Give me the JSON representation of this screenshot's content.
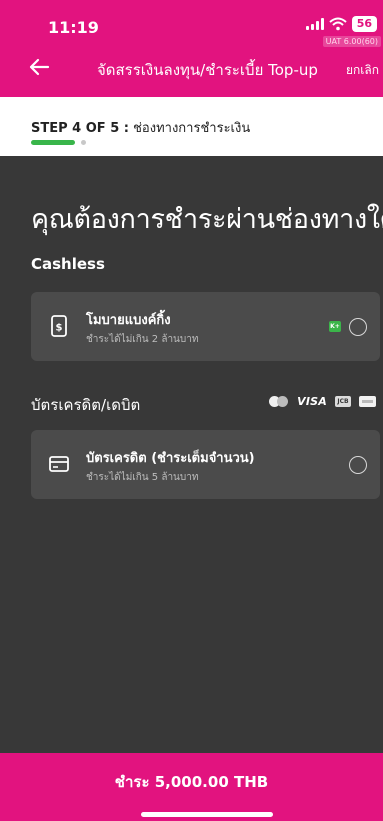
{
  "status_bar": {
    "time": "11:19",
    "battery": "56",
    "env_badge": "UAT 6.00(60)"
  },
  "nav": {
    "title": "จัดสรรเงินลงทุน/ชำระเบี้ย Top-up",
    "cancel": "ยกเลิก"
  },
  "step": {
    "label": "STEP 4 OF 5 :",
    "description": "ช่องทางการชำระเงิน",
    "progress_fraction": 0.8
  },
  "main": {
    "question": "คุณต้องการชำระผ่านช่องทางใด",
    "sections": {
      "cashless": {
        "title": "Cashless",
        "option": {
          "name": "โมบายแบงค์กิ้ง",
          "limit": "ชำระได้ไม่เกิน 2 ล้านบาท",
          "badge": "K+"
        }
      },
      "card": {
        "title": "บัตรเครดิต/เดบิต",
        "brands": {
          "visa": "VISA",
          "jcb": "JCB"
        },
        "option": {
          "name": "บัตรเครดิต (ชำระเต็มจำนวน)",
          "limit": "ชำระได้ไม่เกิน 5 ล้านบาท"
        }
      }
    }
  },
  "footer": {
    "pay_label": "ชำระ 5,000.00 THB"
  },
  "colors": {
    "brand_pink": "#e2137f",
    "dark_bg": "#383838",
    "card_bg": "#4b4b4b",
    "progress_green": "#39b54a"
  },
  "icons": {
    "back": "arrow-left-icon",
    "mobile_banking": "phone-dollar-icon",
    "credit_card": "credit-card-icon"
  }
}
